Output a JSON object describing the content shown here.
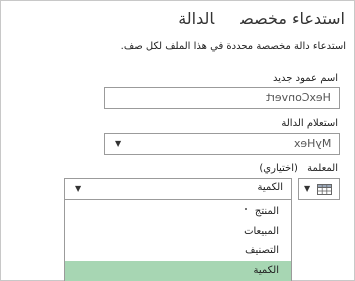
{
  "dialog": {
    "tab_function": "الدالة",
    "tab_custom_call": "استدعاء مخصص",
    "subtitle": "استدعاء دالة مخصصة محددة في هذا الملف لكل صف."
  },
  "new_column_name": {
    "label": "اسم عمود جديد",
    "value": "HexConvert"
  },
  "function_call": {
    "label": "استعلام الدالة",
    "value": "MyHex"
  },
  "parameter": {
    "label": "المعلمة",
    "optional": "(اختياري)",
    "value": "الكمية",
    "options": [
      "المنتج",
      "المبيعات",
      "التصنيف",
      "الكمية"
    ],
    "selected_index": 3
  },
  "icons": {
    "dropdown_arrow": "chevron-down-icon",
    "column_type": "table-grid-icon"
  },
  "colors": {
    "selected_option": "#a7d6b3",
    "border": "#9b9b9b"
  }
}
